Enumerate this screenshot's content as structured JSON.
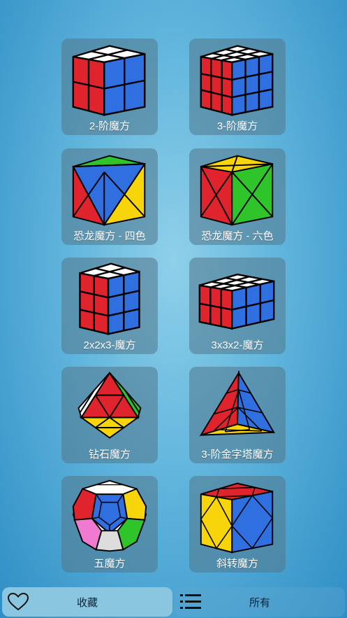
{
  "puzzles": [
    {
      "label": "2-阶魔方",
      "icon": "cube-2x2-icon"
    },
    {
      "label": "3-阶魔方",
      "icon": "cube-3x3-icon"
    },
    {
      "label": "恐龙魔方 - 四色",
      "icon": "dino-cube-four-color-icon"
    },
    {
      "label": "恐龙魔方 - 六色",
      "icon": "dino-cube-six-color-icon"
    },
    {
      "label": "2x2x3-魔方",
      "icon": "cuboid-2x2x3-icon"
    },
    {
      "label": "3x3x2-魔方",
      "icon": "cuboid-3x3x2-icon"
    },
    {
      "label": "钻石魔方",
      "icon": "diamond-octahedron-icon"
    },
    {
      "label": "3-阶金字塔魔方",
      "icon": "pyraminx-icon"
    },
    {
      "label": "五魔方",
      "icon": "megaminx-icon"
    },
    {
      "label": "斜转魔方",
      "icon": "skewb-icon"
    }
  ],
  "tabs": {
    "favorites": {
      "label": "收藏",
      "icon": "heart-icon"
    },
    "all": {
      "label": "所有",
      "icon": "list-icon"
    }
  },
  "colors": {
    "red": "#e0242e",
    "blue": "#2f6fe0",
    "green": "#2fc42a",
    "yellow": "#f7d50a",
    "white": "#ffffff",
    "pink": "#f07ad0"
  }
}
